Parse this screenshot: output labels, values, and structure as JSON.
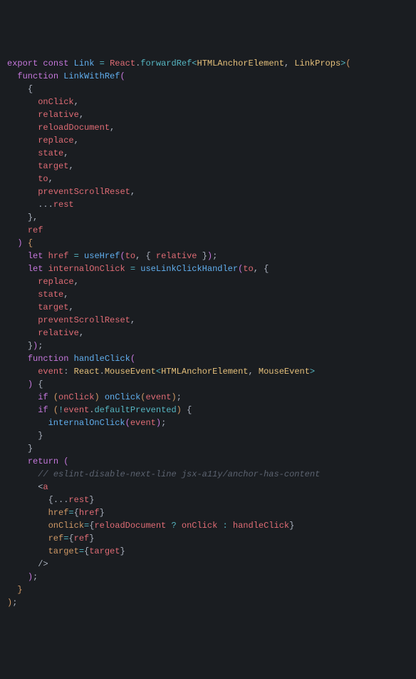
{
  "code": {
    "tokens": [
      [
        [
          "kw",
          "export"
        ],
        [
          "white",
          " "
        ],
        [
          "kw",
          "const"
        ],
        [
          "white",
          " "
        ],
        [
          "def",
          "Link"
        ],
        [
          "white",
          " "
        ],
        [
          "op",
          "="
        ],
        [
          "white",
          " "
        ],
        [
          "var",
          "React"
        ],
        [
          "pun",
          "."
        ],
        [
          "prop",
          "forwardRef"
        ],
        [
          "op",
          "<"
        ],
        [
          "type",
          "HTMLAnchorElement"
        ],
        [
          "pun",
          ","
        ],
        [
          "white",
          " "
        ],
        [
          "type",
          "LinkProps"
        ],
        [
          "op",
          ">"
        ],
        [
          "brk",
          "("
        ]
      ],
      [
        [
          "white",
          "  "
        ],
        [
          "kw",
          "function"
        ],
        [
          "white",
          " "
        ],
        [
          "def",
          "LinkWithRef"
        ],
        [
          "brk2",
          "("
        ]
      ],
      [
        [
          "white",
          "    "
        ],
        [
          "pun",
          "{"
        ]
      ],
      [
        [
          "white",
          "      "
        ],
        [
          "var",
          "onClick"
        ],
        [
          "pun",
          ","
        ]
      ],
      [
        [
          "white",
          "      "
        ],
        [
          "var",
          "relative"
        ],
        [
          "pun",
          ","
        ]
      ],
      [
        [
          "white",
          "      "
        ],
        [
          "var",
          "reloadDocument"
        ],
        [
          "pun",
          ","
        ]
      ],
      [
        [
          "white",
          "      "
        ],
        [
          "var",
          "replace"
        ],
        [
          "pun",
          ","
        ]
      ],
      [
        [
          "white",
          "      "
        ],
        [
          "var",
          "state"
        ],
        [
          "pun",
          ","
        ]
      ],
      [
        [
          "white",
          "      "
        ],
        [
          "var",
          "target"
        ],
        [
          "pun",
          ","
        ]
      ],
      [
        [
          "white",
          "      "
        ],
        [
          "var",
          "to"
        ],
        [
          "pun",
          ","
        ]
      ],
      [
        [
          "white",
          "      "
        ],
        [
          "var",
          "preventScrollReset"
        ],
        [
          "pun",
          ","
        ]
      ],
      [
        [
          "white",
          "      "
        ],
        [
          "pun",
          "..."
        ],
        [
          "var",
          "rest"
        ]
      ],
      [
        [
          "white",
          "    "
        ],
        [
          "pun",
          "}"
        ],
        [
          "pun",
          ","
        ]
      ],
      [
        [
          "white",
          "    "
        ],
        [
          "var",
          "ref"
        ]
      ],
      [
        [
          "white",
          "  "
        ],
        [
          "brk2",
          ")"
        ],
        [
          "white",
          " "
        ],
        [
          "brk",
          "{"
        ]
      ],
      [
        [
          "white",
          "    "
        ],
        [
          "kw",
          "let"
        ],
        [
          "white",
          " "
        ],
        [
          "var",
          "href"
        ],
        [
          "white",
          " "
        ],
        [
          "op",
          "="
        ],
        [
          "white",
          " "
        ],
        [
          "def",
          "useHref"
        ],
        [
          "brk2",
          "("
        ],
        [
          "var",
          "to"
        ],
        [
          "pun",
          ","
        ],
        [
          "white",
          " "
        ],
        [
          "pun",
          "{"
        ],
        [
          "white",
          " "
        ],
        [
          "var",
          "relative"
        ],
        [
          "white",
          " "
        ],
        [
          "pun",
          "}"
        ],
        [
          "brk2",
          ")"
        ],
        [
          "pun",
          ";"
        ]
      ],
      [
        [
          "white",
          "    "
        ],
        [
          "kw",
          "let"
        ],
        [
          "white",
          " "
        ],
        [
          "var",
          "internalOnClick"
        ],
        [
          "white",
          " "
        ],
        [
          "op",
          "="
        ],
        [
          "white",
          " "
        ],
        [
          "def",
          "useLinkClickHandler"
        ],
        [
          "brk2",
          "("
        ],
        [
          "var",
          "to"
        ],
        [
          "pun",
          ","
        ],
        [
          "white",
          " "
        ],
        [
          "pun",
          "{"
        ]
      ],
      [
        [
          "white",
          "      "
        ],
        [
          "var",
          "replace"
        ],
        [
          "pun",
          ","
        ]
      ],
      [
        [
          "white",
          "      "
        ],
        [
          "var",
          "state"
        ],
        [
          "pun",
          ","
        ]
      ],
      [
        [
          "white",
          "      "
        ],
        [
          "var",
          "target"
        ],
        [
          "pun",
          ","
        ]
      ],
      [
        [
          "white",
          "      "
        ],
        [
          "var",
          "preventScrollReset"
        ],
        [
          "pun",
          ","
        ]
      ],
      [
        [
          "white",
          "      "
        ],
        [
          "var",
          "relative"
        ],
        [
          "pun",
          ","
        ]
      ],
      [
        [
          "white",
          "    "
        ],
        [
          "pun",
          "}"
        ],
        [
          "brk2",
          ")"
        ],
        [
          "pun",
          ";"
        ]
      ],
      [
        [
          "white",
          "    "
        ],
        [
          "kw",
          "function"
        ],
        [
          "white",
          " "
        ],
        [
          "def",
          "handleClick"
        ],
        [
          "brk2",
          "("
        ]
      ],
      [
        [
          "white",
          "      "
        ],
        [
          "var",
          "event"
        ],
        [
          "pun",
          ":"
        ],
        [
          "white",
          " "
        ],
        [
          "type",
          "React"
        ],
        [
          "pun",
          "."
        ],
        [
          "type",
          "MouseEvent"
        ],
        [
          "op",
          "<"
        ],
        [
          "type",
          "HTMLAnchorElement"
        ],
        [
          "pun",
          ","
        ],
        [
          "white",
          " "
        ],
        [
          "type",
          "MouseEvent"
        ],
        [
          "op",
          ">"
        ]
      ],
      [
        [
          "white",
          "    "
        ],
        [
          "brk2",
          ")"
        ],
        [
          "white",
          " "
        ],
        [
          "pun",
          "{"
        ]
      ],
      [
        [
          "white",
          "      "
        ],
        [
          "kw",
          "if"
        ],
        [
          "white",
          " "
        ],
        [
          "brk",
          "("
        ],
        [
          "var",
          "onClick"
        ],
        [
          "brk",
          ")"
        ],
        [
          "white",
          " "
        ],
        [
          "def",
          "onClick"
        ],
        [
          "brk",
          "("
        ],
        [
          "var",
          "event"
        ],
        [
          "brk",
          ")"
        ],
        [
          "pun",
          ";"
        ]
      ],
      [
        [
          "white",
          "      "
        ],
        [
          "kw",
          "if"
        ],
        [
          "white",
          " "
        ],
        [
          "brk",
          "("
        ],
        [
          "op",
          "!"
        ],
        [
          "var",
          "event"
        ],
        [
          "pun",
          "."
        ],
        [
          "prop",
          "defaultPrevented"
        ],
        [
          "brk",
          ")"
        ],
        [
          "white",
          " "
        ],
        [
          "pun",
          "{"
        ]
      ],
      [
        [
          "white",
          "        "
        ],
        [
          "def",
          "internalOnClick"
        ],
        [
          "brk2",
          "("
        ],
        [
          "var",
          "event"
        ],
        [
          "brk2",
          ")"
        ],
        [
          "pun",
          ";"
        ]
      ],
      [
        [
          "white",
          "      "
        ],
        [
          "pun",
          "}"
        ]
      ],
      [
        [
          "white",
          "    "
        ],
        [
          "pun",
          "}"
        ]
      ],
      [
        [
          "white",
          ""
        ]
      ],
      [
        [
          "white",
          "    "
        ],
        [
          "kw",
          "return"
        ],
        [
          "white",
          " "
        ],
        [
          "brk2",
          "("
        ]
      ],
      [
        [
          "white",
          "      "
        ],
        [
          "cmt",
          "// eslint-disable-next-line jsx-a11y/anchor-has-content"
        ]
      ],
      [
        [
          "white",
          "      "
        ],
        [
          "pun",
          "<"
        ],
        [
          "jsx",
          "a"
        ]
      ],
      [
        [
          "white",
          "        "
        ],
        [
          "pun",
          "{"
        ],
        [
          "pun",
          "..."
        ],
        [
          "var",
          "rest"
        ],
        [
          "pun",
          "}"
        ]
      ],
      [
        [
          "white",
          "        "
        ],
        [
          "attr",
          "href"
        ],
        [
          "op",
          "="
        ],
        [
          "pun",
          "{"
        ],
        [
          "var",
          "href"
        ],
        [
          "pun",
          "}"
        ]
      ],
      [
        [
          "white",
          "        "
        ],
        [
          "attr",
          "onClick"
        ],
        [
          "op",
          "="
        ],
        [
          "pun",
          "{"
        ],
        [
          "var",
          "reloadDocument"
        ],
        [
          "white",
          " "
        ],
        [
          "op",
          "?"
        ],
        [
          "white",
          " "
        ],
        [
          "var",
          "onClick"
        ],
        [
          "white",
          " "
        ],
        [
          "op",
          ":"
        ],
        [
          "white",
          " "
        ],
        [
          "var",
          "handleClick"
        ],
        [
          "pun",
          "}"
        ]
      ],
      [
        [
          "white",
          "        "
        ],
        [
          "attr",
          "ref"
        ],
        [
          "op",
          "="
        ],
        [
          "pun",
          "{"
        ],
        [
          "var",
          "ref"
        ],
        [
          "pun",
          "}"
        ]
      ],
      [
        [
          "white",
          "        "
        ],
        [
          "attr",
          "target"
        ],
        [
          "op",
          "="
        ],
        [
          "pun",
          "{"
        ],
        [
          "var",
          "target"
        ],
        [
          "pun",
          "}"
        ]
      ],
      [
        [
          "white",
          "      "
        ],
        [
          "pun",
          "/>"
        ]
      ],
      [
        [
          "white",
          "    "
        ],
        [
          "brk2",
          ")"
        ],
        [
          "pun",
          ";"
        ]
      ],
      [
        [
          "white",
          "  "
        ],
        [
          "brk",
          "}"
        ]
      ],
      [
        [
          "brk",
          ")"
        ],
        [
          "pun",
          ";"
        ]
      ]
    ]
  }
}
